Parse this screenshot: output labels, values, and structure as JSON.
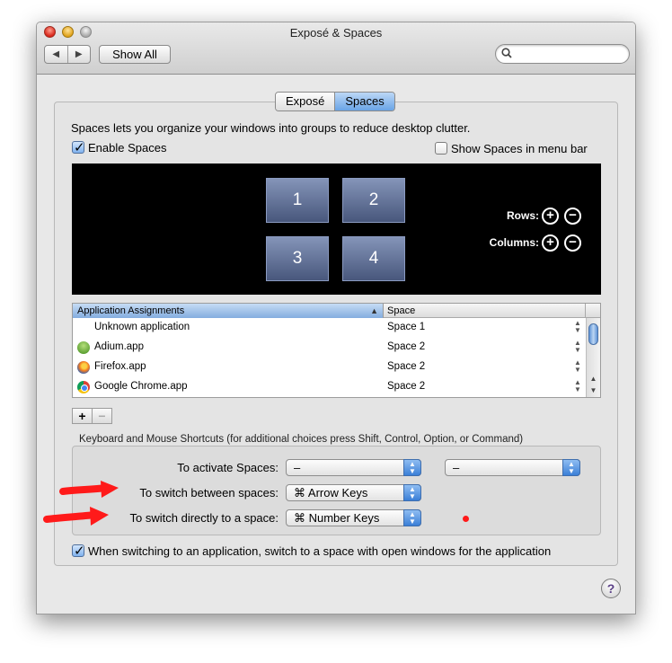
{
  "window": {
    "title": "Exposé & Spaces"
  },
  "toolbar": {
    "back_icon": "◀",
    "forward_icon": "▶",
    "show_all_label": "Show All",
    "search_placeholder": "",
    "search_icon": "🔍"
  },
  "tabs": [
    {
      "label": "Exposé",
      "active": false
    },
    {
      "label": "Spaces",
      "active": true
    }
  ],
  "spaces_pane": {
    "description": "Spaces lets you organize your windows into groups to reduce desktop clutter.",
    "enable_spaces": {
      "label": "Enable Spaces",
      "checked": true
    },
    "show_in_menubar": {
      "label": "Show Spaces in menu bar",
      "checked": false
    },
    "spaces": [
      "1",
      "2",
      "3",
      "4"
    ],
    "rows_label": "Rows:",
    "columns_label": "Columns:",
    "plus_icon": "+",
    "minus_icon": "−"
  },
  "assignments": {
    "columns": [
      "Application Assignments",
      "Space"
    ],
    "sort_icon": "▲",
    "rows": [
      {
        "app": "Unknown application",
        "space": "Space 1",
        "icon": "none"
      },
      {
        "app": "Adium.app",
        "space": "Space 2",
        "icon": "adium-icon"
      },
      {
        "app": "Firefox.app",
        "space": "Space 2",
        "icon": "firefox-icon"
      },
      {
        "app": "Google Chrome.app",
        "space": "Space 2",
        "icon": "chrome-icon"
      }
    ],
    "add_label": "+",
    "remove_label": "−"
  },
  "shortcuts": {
    "header": "Keyboard and Mouse Shortcuts (for additional choices press Shift, Control, Option, or Command)",
    "activate": {
      "label": "To activate Spaces:",
      "value1": "–",
      "value2": "–"
    },
    "switch_between": {
      "label": "To switch between spaces:",
      "value": "⌘ Arrow Keys"
    },
    "switch_directly": {
      "label": "To switch directly to a space:",
      "value": "⌘ Number Keys"
    }
  },
  "bottom_check": {
    "label": "When switching to an application, switch to a space with open windows for the application",
    "checked": true
  },
  "help_label": "?",
  "annotation_color": "#ff1a1a"
}
